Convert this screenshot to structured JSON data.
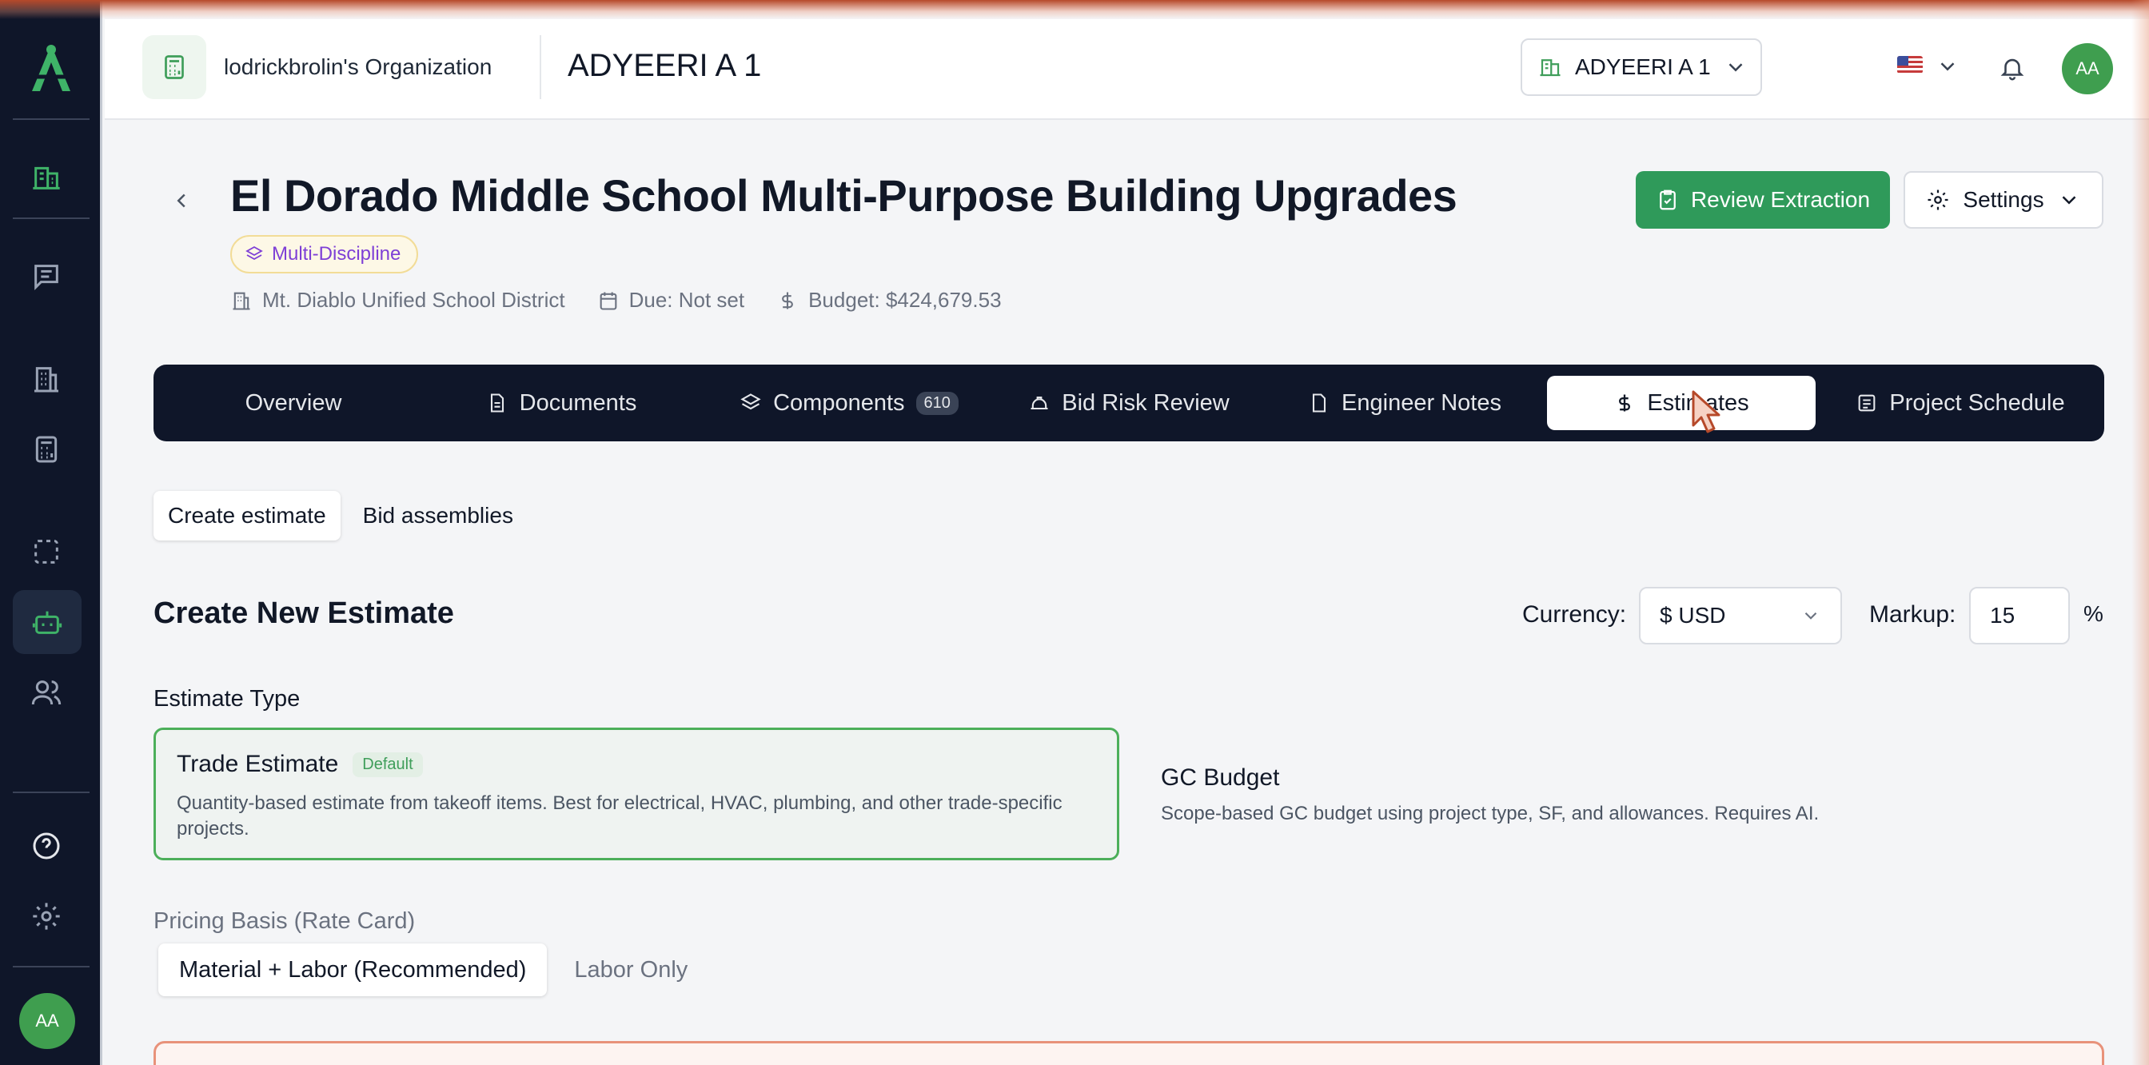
{
  "sidebar": {
    "avatar_initials": "AA",
    "items": [
      {
        "icon": "building-chart-icon",
        "active": true
      },
      {
        "icon": "message-icon"
      },
      {
        "icon": "office-building-icon"
      },
      {
        "icon": "calculator-icon"
      },
      {
        "icon": "selection-icon"
      },
      {
        "icon": "bot-icon",
        "active": true
      },
      {
        "icon": "users-icon"
      },
      {
        "icon": "help-icon"
      },
      {
        "icon": "gear-icon"
      }
    ]
  },
  "header": {
    "org_name": "lodrickbrolin's Organization",
    "project_name": "ADYEERI A 1",
    "project_selector": "ADYEERI A 1",
    "avatar_initials": "AA"
  },
  "project": {
    "title": "El Dorado Middle School Multi-Purpose Building Upgrades",
    "discipline": "Multi-Discipline",
    "district": "Mt. Diablo Unified School District",
    "due": "Due: Not set",
    "budget": "Budget: $424,679.53",
    "review_button": "Review Extraction",
    "settings_button": "Settings"
  },
  "tabs": [
    {
      "label": "Overview"
    },
    {
      "label": "Documents"
    },
    {
      "label": "Components",
      "count": "610"
    },
    {
      "label": "Bid Risk Review"
    },
    {
      "label": "Engineer Notes"
    },
    {
      "label": "Estimates",
      "active": true
    },
    {
      "label": "Project Schedule"
    }
  ],
  "subtabs": {
    "create": "Create estimate",
    "assemblies": "Bid assemblies"
  },
  "estimate": {
    "section_title": "Create New Estimate",
    "currency_label": "Currency:",
    "currency_value": "$ USD",
    "markup_label": "Markup:",
    "markup_value": "15",
    "markup_unit": "%",
    "type_label": "Estimate Type",
    "trade_title": "Trade Estimate",
    "trade_badge": "Default",
    "trade_desc": "Quantity-based estimate from takeoff items. Best for electrical, HVAC, plumbing, and other trade-specific projects.",
    "gc_title": "GC Budget",
    "gc_desc": "Scope-based GC budget using project type, SF, and allowances. Requires AI.",
    "pricing_label": "Pricing Basis (Rate Card)",
    "pricing_options": [
      "Material + Labor (Recommended)",
      "Labor Only"
    ]
  },
  "colors": {
    "sidebar_bg": "#0f1629",
    "accent_green": "#2f9a5a",
    "discipline_purple": "#7e3fd6"
  }
}
